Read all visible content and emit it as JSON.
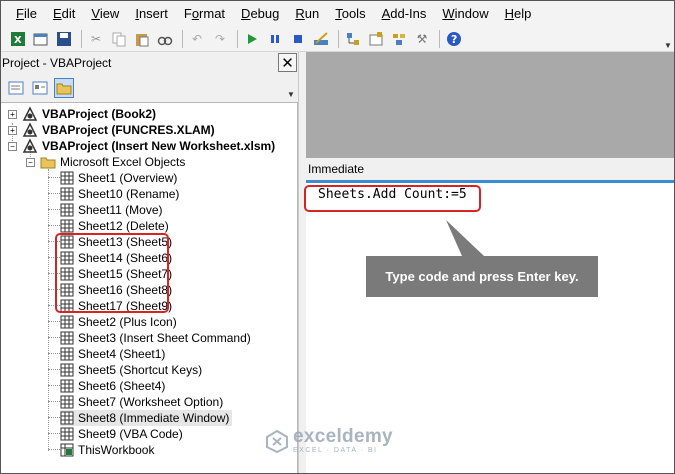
{
  "menu": [
    "File",
    "Edit",
    "View",
    "Insert",
    "Format",
    "Debug",
    "Run",
    "Tools",
    "Add-Ins",
    "Window",
    "Help"
  ],
  "menu_underline": [
    "F",
    "E",
    "V",
    "I",
    "o",
    "D",
    "R",
    "T",
    "A",
    "W",
    "H"
  ],
  "project": {
    "title": "Project - VBAProject",
    "items": [
      {
        "label": "VBAProject (Book2)"
      },
      {
        "label": "VBAProject (FUNCRES.XLAM)"
      },
      {
        "label": "VBAProject (Insert New Worksheet.xlsm)"
      },
      {
        "label": "Microsoft Excel Objects"
      },
      {
        "label": "Sheet1 (Overview)"
      },
      {
        "label": "Sheet10 (Rename)"
      },
      {
        "label": "Sheet11 (Move)"
      },
      {
        "label": "Sheet12 (Delete)"
      },
      {
        "label": "Sheet13 (Sheet5)"
      },
      {
        "label": "Sheet14 (Sheet6)"
      },
      {
        "label": "Sheet15 (Sheet7)"
      },
      {
        "label": "Sheet16 (Sheet8)"
      },
      {
        "label": "Sheet17 (Sheet9)"
      },
      {
        "label": "Sheet2 (Plus Icon)"
      },
      {
        "label": "Sheet3 (Insert Sheet Command)"
      },
      {
        "label": "Sheet4 (Sheet1)"
      },
      {
        "label": "Sheet5 (Shortcut Keys)"
      },
      {
        "label": "Sheet6 (Sheet4)"
      },
      {
        "label": "Sheet7 (Worksheet Option)"
      },
      {
        "label": "Sheet8 (Immediate Window)"
      },
      {
        "label": "Sheet9 (VBA Code)"
      },
      {
        "label": "ThisWorkbook"
      }
    ]
  },
  "immediate": {
    "title": "Immediate",
    "code": "Sheets.Add Count:=5"
  },
  "callout": "Type code and press Enter key.",
  "watermark": {
    "name": "exceldemy",
    "sub": "EXCEL · DATA · BI"
  },
  "colors": {
    "highlight": "#d62424",
    "callout": "#7a7a7a",
    "accent": "#3a8bd0"
  }
}
